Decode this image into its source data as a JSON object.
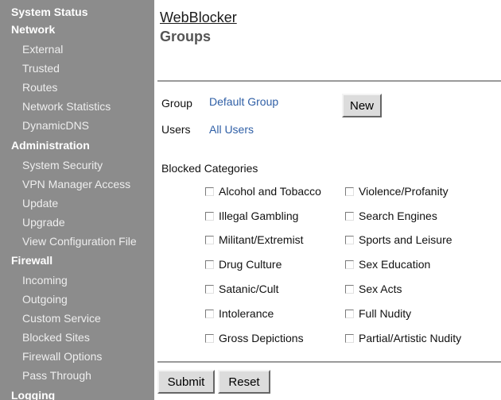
{
  "sidebar": {
    "sections": [
      {
        "label": "System Status",
        "items": []
      },
      {
        "label": "Network",
        "items": [
          "External",
          "Trusted",
          "Routes",
          "Network Statistics",
          "DynamicDNS"
        ]
      },
      {
        "label": "Administration",
        "items": [
          "System Security",
          "VPN Manager Access",
          "Update",
          "Upgrade",
          "View Configuration File"
        ]
      },
      {
        "label": "Firewall",
        "items": [
          "Incoming",
          "Outgoing",
          "Custom Service",
          "Blocked Sites",
          "Firewall Options",
          "Pass Through"
        ]
      },
      {
        "label": "Logging",
        "items": []
      }
    ]
  },
  "header": {
    "breadcrumb": "WebBlocker",
    "title": "Groups"
  },
  "form": {
    "group_label": "Group",
    "group_value": "Default Group",
    "new_button": "New",
    "users_label": "Users",
    "users_value": "All Users",
    "blocked_categories_label": "Blocked Categories",
    "categories_left": [
      "Alcohol and Tobacco",
      "Illegal Gambling",
      "Militant/Extremist",
      "Drug Culture",
      "Satanic/Cult",
      "Intolerance",
      "Gross Depictions"
    ],
    "categories_right": [
      "Violence/Profanity",
      "Search Engines",
      "Sports and Leisure",
      "Sex Education",
      "Sex Acts",
      "Full Nudity",
      "Partial/Artistic Nudity"
    ],
    "submit_button": "Submit",
    "reset_button": "Reset"
  }
}
